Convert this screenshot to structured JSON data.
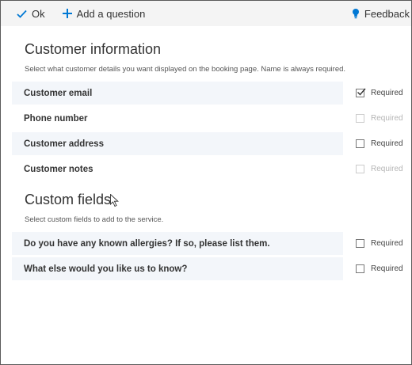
{
  "toolbar": {
    "ok_label": "Ok",
    "add_question_label": "Add a question",
    "feedback_label": "Feedback"
  },
  "customer_info": {
    "title": "Customer information",
    "description": "Select what customer details you want displayed on the booking page. Name is always required.",
    "rows": [
      {
        "label": "Customer email",
        "required_label": "Required",
        "checked": true,
        "disabled": false
      },
      {
        "label": "Phone number",
        "required_label": "Required",
        "checked": false,
        "disabled": true
      },
      {
        "label": "Customer address",
        "required_label": "Required",
        "checked": false,
        "disabled": false
      },
      {
        "label": "Customer notes",
        "required_label": "Required",
        "checked": false,
        "disabled": true
      }
    ]
  },
  "custom_fields": {
    "title": "Custom fields",
    "description": "Select custom fields to add to the service.",
    "rows": [
      {
        "label": "Do you have any known allergies? If so, please list them.",
        "required_label": "Required",
        "checked": false,
        "disabled": false
      },
      {
        "label": "What else would you like us to know?",
        "required_label": "Required",
        "checked": false,
        "disabled": false
      }
    ]
  },
  "colors": {
    "accent": "#0078d4",
    "row_shade": "#f3f6fa",
    "toolbar_bg": "#f4f4f4"
  }
}
